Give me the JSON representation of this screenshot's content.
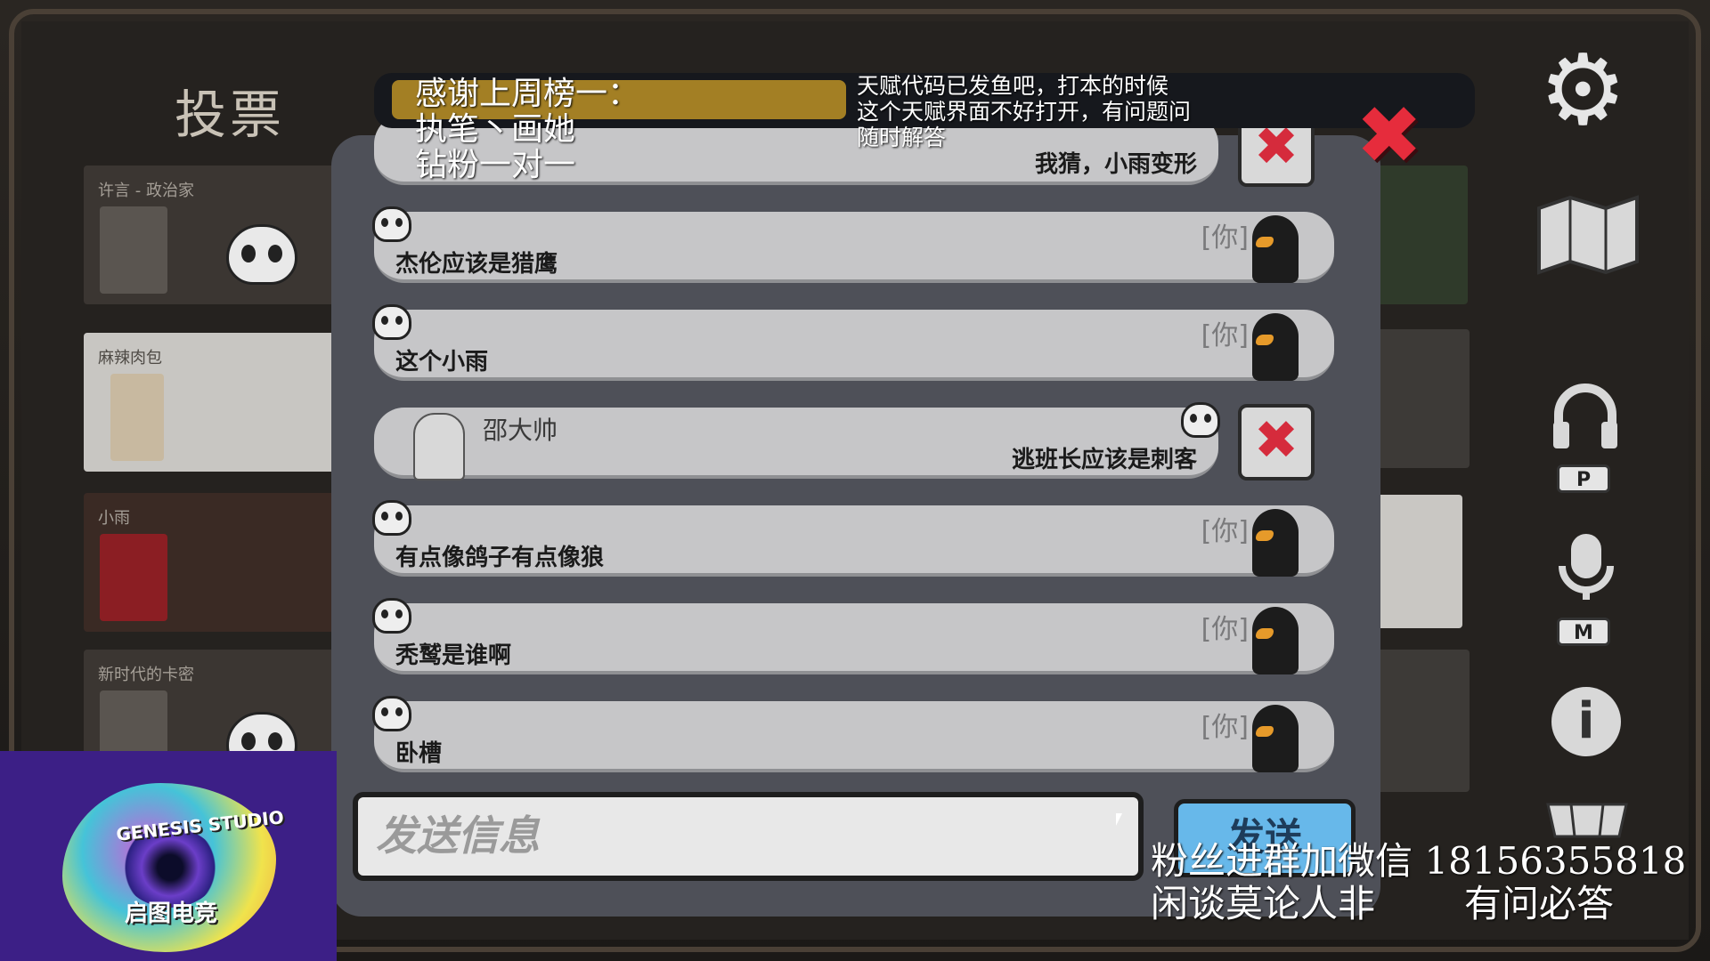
{
  "screen_title": "投票",
  "players": [
    {
      "name": "许言 - 政治家",
      "status": "dead"
    },
    {
      "name": "麻辣肉包",
      "status": "alive"
    },
    {
      "name": "小雨",
      "status": "alive"
    },
    {
      "name": "新时代的卡密",
      "status": "dead"
    }
  ],
  "chat": {
    "messages": [
      {
        "text": "我猜，小雨变形",
        "side": "right",
        "partial": true
      },
      {
        "text": "杰伦应该是猎鹰",
        "you_tag": "[你]",
        "side": "left"
      },
      {
        "text": "这个小雨",
        "you_tag": "[你]",
        "side": "left"
      },
      {
        "author": "邵大帅",
        "text": "逃班长应该是刺客",
        "side": "right"
      },
      {
        "text": "有点像鸽子有点像狼",
        "you_tag": "[你]",
        "side": "left"
      },
      {
        "text": "秃鹫是谁啊",
        "you_tag": "[你]",
        "side": "left"
      },
      {
        "text": "卧槽",
        "you_tag": "[你]",
        "side": "left"
      }
    ],
    "input_placeholder": "发送信息",
    "send_label": "发送",
    "close_icon": "close-x-icon"
  },
  "side_icons": [
    {
      "icon": "gear-icon"
    },
    {
      "icon": "map-icon"
    },
    {
      "icon": "headphones-icon",
      "key": "P"
    },
    {
      "icon": "microphone-icon",
      "key": "M"
    },
    {
      "icon": "info-icon"
    },
    {
      "icon": "shop-icon"
    }
  ],
  "stream_overlay": {
    "banner_left_lines": [
      "感谢上周榜一：",
      "执笔丶画她",
      "钻粉一对一"
    ],
    "banner_right_lines": [
      "天赋代码已发鱼吧，打本的时候",
      "这个天赋界面不好打开，有问题问",
      "随时解答"
    ],
    "bottom_line1": "粉丝进群加微信 18156355818",
    "bottom_line2_left": "闲谈莫论人非",
    "bottom_line2_right": "有问必答",
    "logo_top": "GENESIS STUDIO",
    "logo_bottom": "启图电竞"
  },
  "colors": {
    "accent_red": "#e62c3c",
    "send_blue": "#67b8ea",
    "banner_gold": "#a37f24"
  }
}
